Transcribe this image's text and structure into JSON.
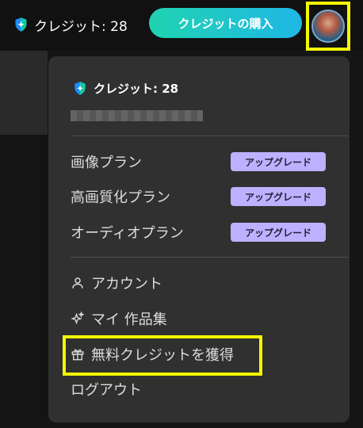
{
  "topbar": {
    "credit_label": "クレジット: 28",
    "buy_button": "クレジットの購入"
  },
  "menu": {
    "credit_label": "クレジット: 28",
    "plans": [
      {
        "label": "画像プラン",
        "badge": "アップグレード"
      },
      {
        "label": "高画質化プラン",
        "badge": "アップグレード"
      },
      {
        "label": "オーディオプラン",
        "badge": "アップグレード"
      }
    ],
    "items": {
      "account": "アカウント",
      "works": "マイ 作品集",
      "free_credits": "無料クレジットを獲得",
      "logout": "ログアウト"
    }
  },
  "colors": {
    "accent_gradient_start": "#20d3b0",
    "accent_gradient_end": "#1fb7e6",
    "badge_bg": "#bdb1ff",
    "highlight": "#f4f800"
  },
  "icons": [
    "shield-icon",
    "user-icon",
    "sparkle-icon",
    "gift-icon"
  ]
}
